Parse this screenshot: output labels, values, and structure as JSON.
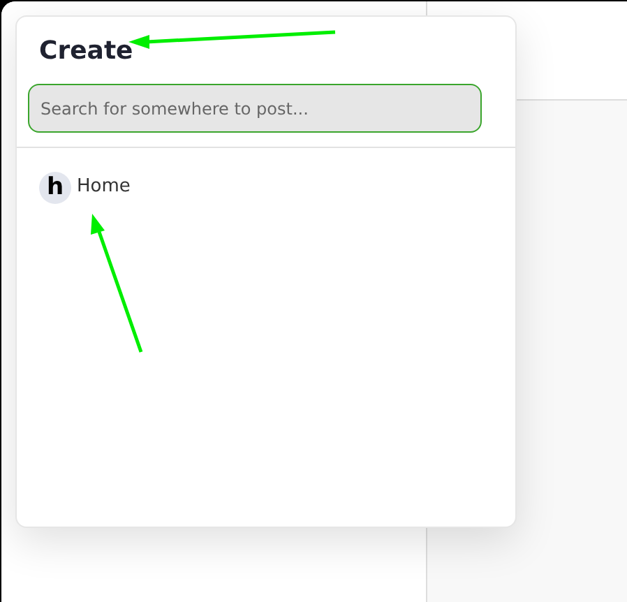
{
  "dialog": {
    "title": "Create",
    "search": {
      "placeholder": "Search for somewhere to post..."
    },
    "items": [
      {
        "avatar_letter": "h",
        "label": "Home"
      }
    ]
  }
}
